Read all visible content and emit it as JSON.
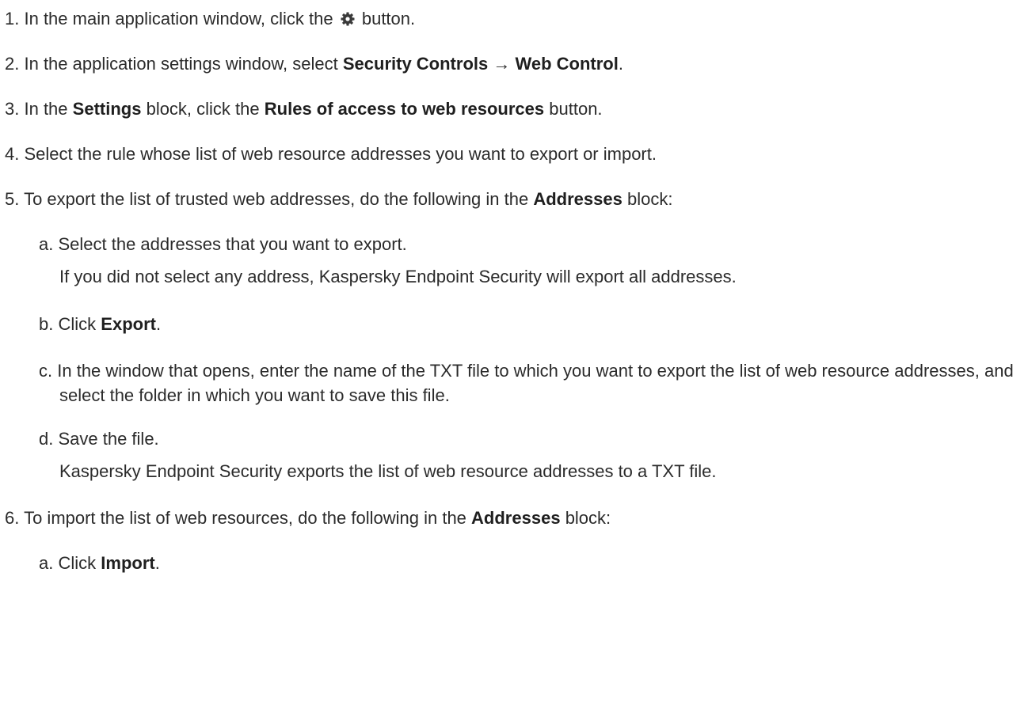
{
  "steps": [
    {
      "num": "1.",
      "before": "In the main application window, click the",
      "icon": "gear-icon",
      "after": "button."
    },
    {
      "num": "2.",
      "before": "In the application settings window, select",
      "bold1": "Security Controls",
      "arrow": "→",
      "bold2": "Web Control",
      "after": "."
    },
    {
      "num": "3.",
      "before": "In the",
      "bold1": "Settings",
      "middle": "block, click the",
      "bold2": "Rules of access to web resources",
      "after": "button."
    },
    {
      "num": "4.",
      "text": "Select the rule whose list of web resource addresses you want to export or import."
    },
    {
      "num": "5.",
      "before": "To export the list of trusted web addresses, do the following in the",
      "bold1": "Addresses",
      "after": "block:",
      "substeps": [
        {
          "label": "a.",
          "text": "Select the addresses that you want to export.",
          "note": "If you did not select any address, Kaspersky Endpoint Security will export all addresses."
        },
        {
          "label": "b.",
          "before": "Click",
          "bold": "Export",
          "after": "."
        },
        {
          "label": "c.",
          "text": "In the window that opens, enter the name of the TXT file to which you want to export the list of web resource addresses, and select the folder in which you want to save this file."
        },
        {
          "label": "d.",
          "text": "Save the file.",
          "note": "Kaspersky Endpoint Security exports the list of web resource addresses to a TXT file."
        }
      ]
    },
    {
      "num": "6.",
      "before": "To import the list of web resources, do the following in the",
      "bold1": "Addresses",
      "after": "block:",
      "substeps": [
        {
          "label": "a.",
          "before": "Click",
          "bold": "Import",
          "after": "."
        }
      ]
    }
  ]
}
